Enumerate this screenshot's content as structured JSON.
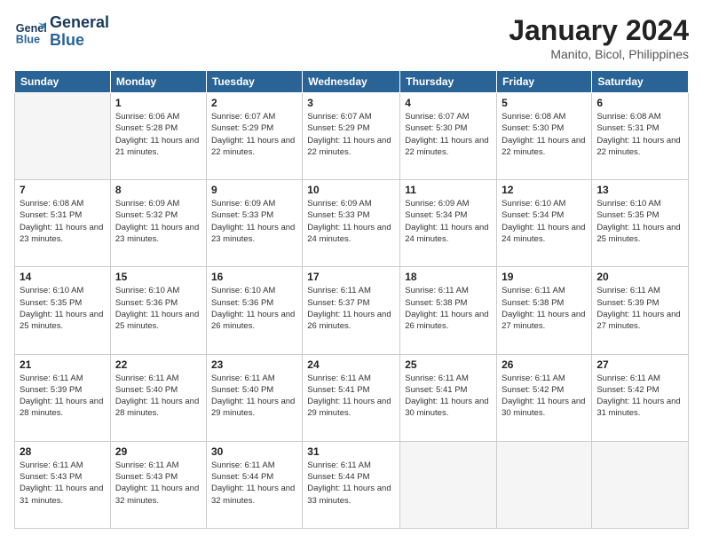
{
  "header": {
    "logo_line1": "General",
    "logo_line2": "Blue",
    "month": "January 2024",
    "location": "Manito, Bicol, Philippines"
  },
  "weekdays": [
    "Sunday",
    "Monday",
    "Tuesday",
    "Wednesday",
    "Thursday",
    "Friday",
    "Saturday"
  ],
  "weeks": [
    [
      {
        "day": "",
        "sunrise": "",
        "sunset": "",
        "daylight": ""
      },
      {
        "day": "1",
        "sunrise": "6:06 AM",
        "sunset": "5:28 PM",
        "daylight": "11 hours and 21 minutes."
      },
      {
        "day": "2",
        "sunrise": "6:07 AM",
        "sunset": "5:29 PM",
        "daylight": "11 hours and 22 minutes."
      },
      {
        "day": "3",
        "sunrise": "6:07 AM",
        "sunset": "5:29 PM",
        "daylight": "11 hours and 22 minutes."
      },
      {
        "day": "4",
        "sunrise": "6:07 AM",
        "sunset": "5:30 PM",
        "daylight": "11 hours and 22 minutes."
      },
      {
        "day": "5",
        "sunrise": "6:08 AM",
        "sunset": "5:30 PM",
        "daylight": "11 hours and 22 minutes."
      },
      {
        "day": "6",
        "sunrise": "6:08 AM",
        "sunset": "5:31 PM",
        "daylight": "11 hours and 22 minutes."
      }
    ],
    [
      {
        "day": "7",
        "sunrise": "6:08 AM",
        "sunset": "5:31 PM",
        "daylight": "11 hours and 23 minutes."
      },
      {
        "day": "8",
        "sunrise": "6:09 AM",
        "sunset": "5:32 PM",
        "daylight": "11 hours and 23 minutes."
      },
      {
        "day": "9",
        "sunrise": "6:09 AM",
        "sunset": "5:33 PM",
        "daylight": "11 hours and 23 minutes."
      },
      {
        "day": "10",
        "sunrise": "6:09 AM",
        "sunset": "5:33 PM",
        "daylight": "11 hours and 24 minutes."
      },
      {
        "day": "11",
        "sunrise": "6:09 AM",
        "sunset": "5:34 PM",
        "daylight": "11 hours and 24 minutes."
      },
      {
        "day": "12",
        "sunrise": "6:10 AM",
        "sunset": "5:34 PM",
        "daylight": "11 hours and 24 minutes."
      },
      {
        "day": "13",
        "sunrise": "6:10 AM",
        "sunset": "5:35 PM",
        "daylight": "11 hours and 25 minutes."
      }
    ],
    [
      {
        "day": "14",
        "sunrise": "6:10 AM",
        "sunset": "5:35 PM",
        "daylight": "11 hours and 25 minutes."
      },
      {
        "day": "15",
        "sunrise": "6:10 AM",
        "sunset": "5:36 PM",
        "daylight": "11 hours and 25 minutes."
      },
      {
        "day": "16",
        "sunrise": "6:10 AM",
        "sunset": "5:36 PM",
        "daylight": "11 hours and 26 minutes."
      },
      {
        "day": "17",
        "sunrise": "6:11 AM",
        "sunset": "5:37 PM",
        "daylight": "11 hours and 26 minutes."
      },
      {
        "day": "18",
        "sunrise": "6:11 AM",
        "sunset": "5:38 PM",
        "daylight": "11 hours and 26 minutes."
      },
      {
        "day": "19",
        "sunrise": "6:11 AM",
        "sunset": "5:38 PM",
        "daylight": "11 hours and 27 minutes."
      },
      {
        "day": "20",
        "sunrise": "6:11 AM",
        "sunset": "5:39 PM",
        "daylight": "11 hours and 27 minutes."
      }
    ],
    [
      {
        "day": "21",
        "sunrise": "6:11 AM",
        "sunset": "5:39 PM",
        "daylight": "11 hours and 28 minutes."
      },
      {
        "day": "22",
        "sunrise": "6:11 AM",
        "sunset": "5:40 PM",
        "daylight": "11 hours and 28 minutes."
      },
      {
        "day": "23",
        "sunrise": "6:11 AM",
        "sunset": "5:40 PM",
        "daylight": "11 hours and 29 minutes."
      },
      {
        "day": "24",
        "sunrise": "6:11 AM",
        "sunset": "5:41 PM",
        "daylight": "11 hours and 29 minutes."
      },
      {
        "day": "25",
        "sunrise": "6:11 AM",
        "sunset": "5:41 PM",
        "daylight": "11 hours and 30 minutes."
      },
      {
        "day": "26",
        "sunrise": "6:11 AM",
        "sunset": "5:42 PM",
        "daylight": "11 hours and 30 minutes."
      },
      {
        "day": "27",
        "sunrise": "6:11 AM",
        "sunset": "5:42 PM",
        "daylight": "11 hours and 31 minutes."
      }
    ],
    [
      {
        "day": "28",
        "sunrise": "6:11 AM",
        "sunset": "5:43 PM",
        "daylight": "11 hours and 31 minutes."
      },
      {
        "day": "29",
        "sunrise": "6:11 AM",
        "sunset": "5:43 PM",
        "daylight": "11 hours and 32 minutes."
      },
      {
        "day": "30",
        "sunrise": "6:11 AM",
        "sunset": "5:44 PM",
        "daylight": "11 hours and 32 minutes."
      },
      {
        "day": "31",
        "sunrise": "6:11 AM",
        "sunset": "5:44 PM",
        "daylight": "11 hours and 33 minutes."
      },
      {
        "day": "",
        "sunrise": "",
        "sunset": "",
        "daylight": ""
      },
      {
        "day": "",
        "sunrise": "",
        "sunset": "",
        "daylight": ""
      },
      {
        "day": "",
        "sunrise": "",
        "sunset": "",
        "daylight": ""
      }
    ]
  ]
}
